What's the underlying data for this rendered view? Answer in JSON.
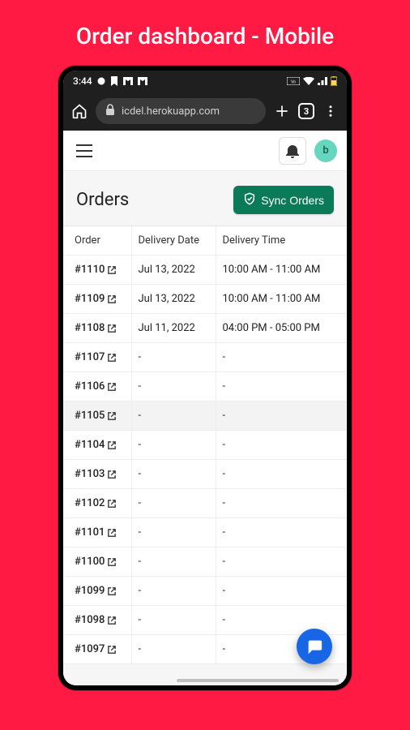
{
  "page_title": "Order dashboard - Mobile",
  "statusbar": {
    "time": "3:44"
  },
  "browser": {
    "url_display": "icdel.herokuapp.com",
    "tab_count": "3"
  },
  "app_header": {
    "avatar_letter": "b"
  },
  "orders_section": {
    "title": "Orders",
    "sync_label": "Sync Orders",
    "columns": {
      "order": "Order",
      "date": "Delivery Date",
      "time": "Delivery Time"
    }
  },
  "orders": [
    {
      "id": "#1110",
      "date": "Jul 13, 2022",
      "time": "10:00 AM - 11:00 AM",
      "highlight": false
    },
    {
      "id": "#1109",
      "date": "Jul 13, 2022",
      "time": "10:00 AM - 11:00 AM",
      "highlight": false
    },
    {
      "id": "#1108",
      "date": "Jul 11, 2022",
      "time": "04:00 PM - 05:00 PM",
      "highlight": false
    },
    {
      "id": "#1107",
      "date": "-",
      "time": "-",
      "highlight": false
    },
    {
      "id": "#1106",
      "date": "-",
      "time": "-",
      "highlight": false
    },
    {
      "id": "#1105",
      "date": "-",
      "time": "-",
      "highlight": true
    },
    {
      "id": "#1104",
      "date": "-",
      "time": "-",
      "highlight": false
    },
    {
      "id": "#1103",
      "date": "-",
      "time": "-",
      "highlight": false
    },
    {
      "id": "#1102",
      "date": "-",
      "time": "-",
      "highlight": false
    },
    {
      "id": "#1101",
      "date": "-",
      "time": "-",
      "highlight": false
    },
    {
      "id": "#1100",
      "date": "-",
      "time": "-",
      "highlight": false
    },
    {
      "id": "#1099",
      "date": "-",
      "time": "-",
      "highlight": false
    },
    {
      "id": "#1098",
      "date": "-",
      "time": "-",
      "highlight": false
    },
    {
      "id": "#1097",
      "date": "-",
      "time": "-",
      "highlight": false
    }
  ]
}
